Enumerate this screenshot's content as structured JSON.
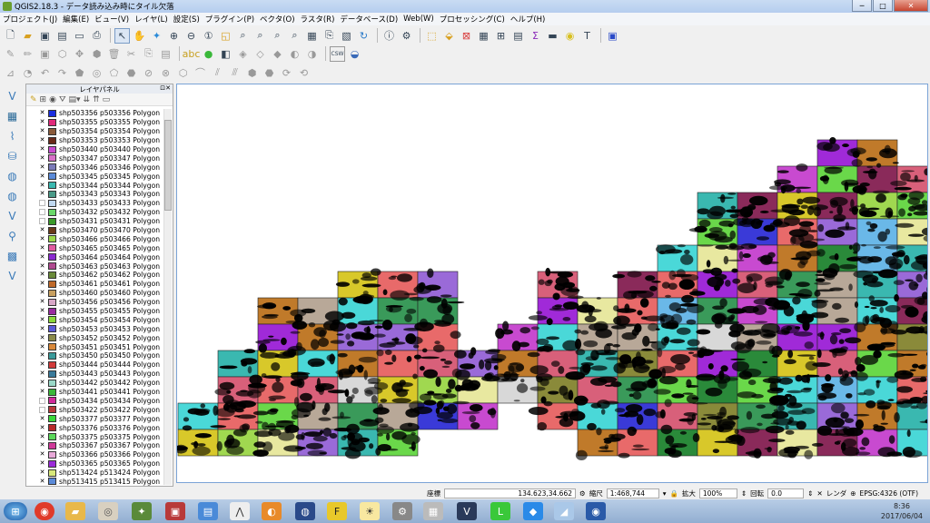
{
  "title": "QGIS2.18.3 - データ読み込み時にタイル欠落",
  "menus": [
    "プロジェクト(J)",
    "編集(E)",
    "ビュー(V)",
    "レイヤ(L)",
    "設定(S)",
    "プラグイン(P)",
    "ベクタ(O)",
    "ラスタ(R)",
    "データベース(D)",
    "Web(W)",
    "プロセッシング(C)",
    "ヘルプ(H)"
  ],
  "panel": {
    "title": "レイヤパネル"
  },
  "layers": [
    {
      "name": "shp503356 p503356 Polygon",
      "on": true,
      "color": "#1a2ee0"
    },
    {
      "name": "shp503355 p503355 Polygon",
      "on": true,
      "color": "#e02a7a"
    },
    {
      "name": "shp503354 p503354 Polygon",
      "on": true,
      "color": "#8a5a3a"
    },
    {
      "name": "shp503353 p503353 Polygon",
      "on": true,
      "color": "#6a2a1a"
    },
    {
      "name": "shp503440 p503440 Polygon",
      "on": true,
      "color": "#c84ad0"
    },
    {
      "name": "shp503347 p503347 Polygon",
      "on": true,
      "color": "#d870c8"
    },
    {
      "name": "shp503346 p503346 Polygon",
      "on": true,
      "color": "#7a7ab8"
    },
    {
      "name": "shp503345 p503345 Polygon",
      "on": true,
      "color": "#5a8ad8"
    },
    {
      "name": "shp503344 p503344 Polygon",
      "on": true,
      "color": "#3ab8b0"
    },
    {
      "name": "shp503343 p503343 Polygon",
      "on": true,
      "color": "#4a9a88"
    },
    {
      "name": "shp503433 p503433 Polygon",
      "on": false,
      "color": "#c0d8f0"
    },
    {
      "name": "shp503432 p503432 Polygon",
      "on": false,
      "color": "#6ad86a"
    },
    {
      "name": "shp503431 p503431 Polygon",
      "on": false,
      "color": "#3a9a2a"
    },
    {
      "name": "shp503470 p503470 Polygon",
      "on": true,
      "color": "#6a3a1a"
    },
    {
      "name": "shp503466 p503466 Polygon",
      "on": true,
      "color": "#9ad84a"
    },
    {
      "name": "shp503465 p503465 Polygon",
      "on": true,
      "color": "#e05aa0"
    },
    {
      "name": "shp503464 p503464 Polygon",
      "on": true,
      "color": "#8a2ad0"
    },
    {
      "name": "shp503463 p503463 Polygon",
      "on": true,
      "color": "#b04a90"
    },
    {
      "name": "shp503462 p503462 Polygon",
      "on": true,
      "color": "#6a8a3a"
    },
    {
      "name": "shp503461 p503461 Polygon",
      "on": true,
      "color": "#c06a2a"
    },
    {
      "name": "shp503460 p503460 Polygon",
      "on": true,
      "color": "#c8a060"
    },
    {
      "name": "shp503456 p503456 Polygon",
      "on": true,
      "color": "#d8a8c8"
    },
    {
      "name": "shp503455 p503455 Polygon",
      "on": true,
      "color": "#9a2aa0"
    },
    {
      "name": "shp503454 p503454 Polygon",
      "on": true,
      "color": "#8ad83a"
    },
    {
      "name": "shp503453 p503453 Polygon",
      "on": true,
      "color": "#5a5ad8"
    },
    {
      "name": "shp503452 p503452 Polygon",
      "on": true,
      "color": "#8a8a4a"
    },
    {
      "name": "shp503451 p503451 Polygon",
      "on": true,
      "color": "#d8883a"
    },
    {
      "name": "shp503450 p503450 Polygon",
      "on": true,
      "color": "#3a9a9a"
    },
    {
      "name": "shp503444 p503444 Polygon",
      "on": true,
      "color": "#d03a3a"
    },
    {
      "name": "shp503443 p503443 Polygon",
      "on": true,
      "color": "#3a7a9a"
    },
    {
      "name": "shp503442 p503442 Polygon",
      "on": true,
      "color": "#9ad8c8"
    },
    {
      "name": "shp503441 p503441 Polygon",
      "on": true,
      "color": "#3ab83a"
    },
    {
      "name": "shp503434 p503434 Polygon",
      "on": false,
      "color": "#d02a9a"
    },
    {
      "name": "shp503422 p503422 Polygon",
      "on": false,
      "color": "#b83a3a"
    },
    {
      "name": "shp503377 p503377 Polygon",
      "on": true,
      "color": "#3ad83a"
    },
    {
      "name": "shp503376 p503376 Polygon",
      "on": true,
      "color": "#b82a2a"
    },
    {
      "name": "shp503375 p503375 Polygon",
      "on": true,
      "color": "#5ad85a"
    },
    {
      "name": "shp503367 p503367 Polygon",
      "on": true,
      "color": "#d03a9a"
    },
    {
      "name": "shp503366 p503366 Polygon",
      "on": true,
      "color": "#e8a8d8"
    },
    {
      "name": "shp503365 p503365 Polygon",
      "on": true,
      "color": "#9a2ad8"
    },
    {
      "name": "shp513424 p513424 Polygon",
      "on": true,
      "color": "#d8e87a"
    },
    {
      "name": "shp513415 p513415 Polygon",
      "on": true,
      "color": "#5a8ad8"
    }
  ],
  "status": {
    "coord_label": "座標",
    "coord_value": "134.623,34.662",
    "scale_label": "縮尺",
    "scale_value": "1:468,744",
    "mag_label": "拡大",
    "mag_value": "100%",
    "rot_label": "回転",
    "rot_value": "0.0",
    "render_label": "レンダ",
    "crs": "EPSG:4326 (OTF)"
  },
  "clock": {
    "time": "8:36",
    "date": "2017/06/04"
  }
}
